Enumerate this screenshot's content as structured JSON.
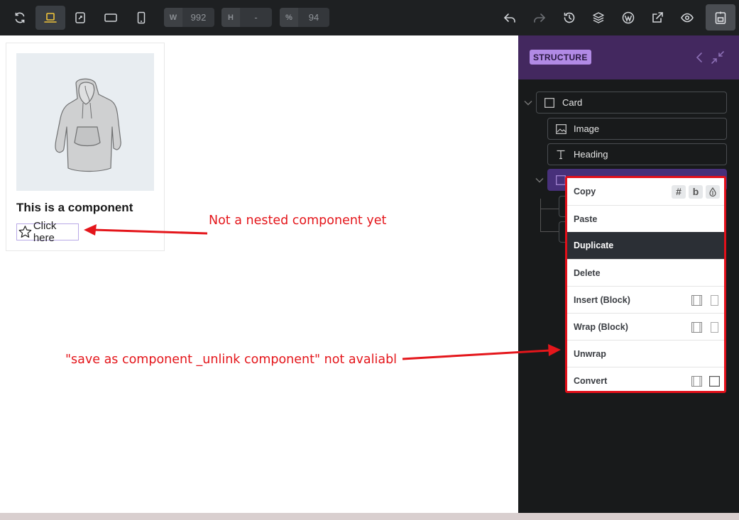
{
  "toolbar": {
    "width_key": "W",
    "width_value": "992",
    "height_key": "H",
    "height_value": "-",
    "zoom_key": "%",
    "zoom_value": "94",
    "accent_color": "#f0c43a",
    "icons": [
      "refresh-icon",
      "laptop-icon",
      "tablet-landscape-icon",
      "tablet-icon",
      "mobile-icon",
      "undo-icon",
      "redo-icon",
      "history-icon",
      "layers-icon",
      "wordpress-icon",
      "external-link-icon",
      "eye-icon",
      "save-icon"
    ]
  },
  "canvas": {
    "card_heading": "This is a component",
    "card_button_label": "Click here"
  },
  "annotations": {
    "nested_note": "Not a nested component yet",
    "unavailable_note": "\"save as component _unlink component\" not avaliabl",
    "color": "#e4161b"
  },
  "structure": {
    "title": "STRUCTURE",
    "nodes": [
      {
        "label": "Card",
        "icon": "square-icon"
      },
      {
        "label": "Image",
        "icon": "image-icon"
      },
      {
        "label": "Heading",
        "icon": "heading-icon"
      }
    ],
    "selected_color": "#47307a"
  },
  "context_menu": {
    "items": [
      {
        "label": "Copy"
      },
      {
        "label": "Paste"
      },
      {
        "label": "Duplicate"
      },
      {
        "label": "Delete"
      },
      {
        "label": "Insert (Block)"
      },
      {
        "label": "Wrap (Block)"
      },
      {
        "label": "Unwrap"
      },
      {
        "label": "Convert"
      }
    ],
    "copy_shortcuts": [
      "#",
      "b",
      "◇"
    ]
  }
}
